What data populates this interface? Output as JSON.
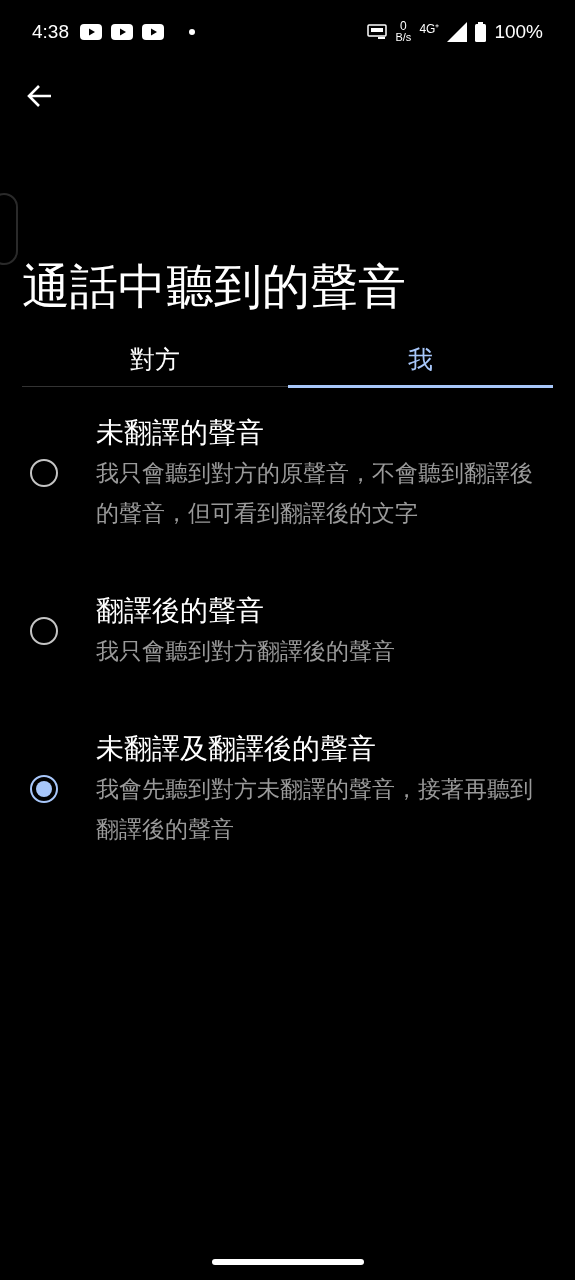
{
  "status_bar": {
    "time": "4:38",
    "net_speed_value": "0",
    "net_speed_unit": "B/s",
    "network": "4G⁺",
    "battery": "100%"
  },
  "title": "通話中聽到的聲音",
  "tabs": [
    {
      "label": "對方",
      "selected": false
    },
    {
      "label": "我",
      "selected": true
    }
  ],
  "options": [
    {
      "title": "未翻譯的聲音",
      "description": "我只會聽到對方的原聲音，不會聽到翻譯後的聲音，但可看到翻譯後的文字",
      "selected": false
    },
    {
      "title": "翻譯後的聲音",
      "description": "我只會聽到對方翻譯後的聲音",
      "selected": false
    },
    {
      "title": "未翻譯及翻譯後的聲音",
      "description": "我會先聽到對方未翻譯的聲音，接著再聽到翻譯後的聲音",
      "selected": true
    }
  ]
}
